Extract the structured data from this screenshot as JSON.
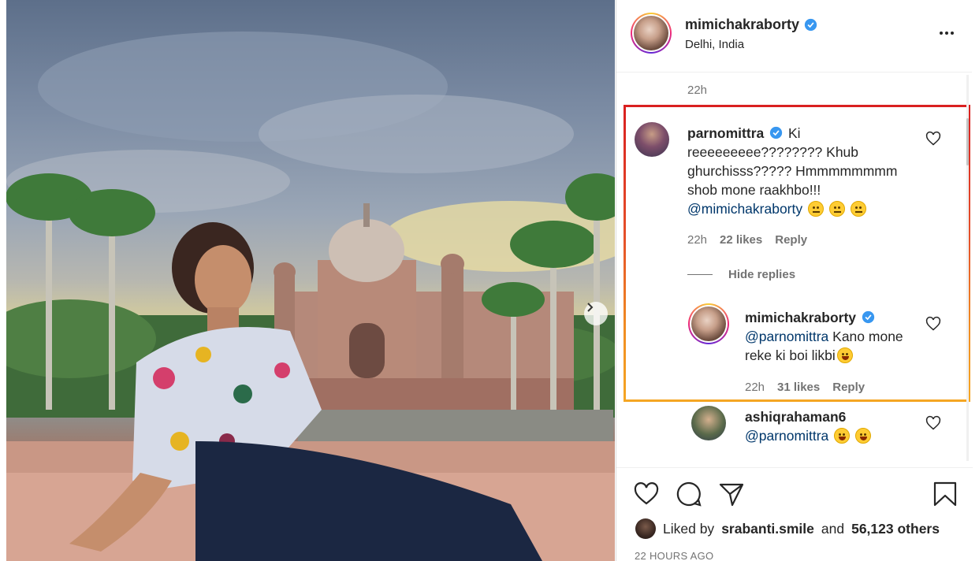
{
  "post": {
    "username": "mimichakraborty",
    "location": "Delhi, India",
    "caption_time": "22h",
    "more_icon": "more-horizontal-icon",
    "verified_color": "#3897f0"
  },
  "comments": [
    {
      "username": "parnomittra",
      "text": "Ki reeeeeeeee???????? Khub ghurchisss????? Hmmmmmmmm shob mone raakhbo!!!",
      "mention": "@mimichakraborty",
      "emojis": [
        "neutral-face-emoji",
        "neutral-face-emoji",
        "neutral-face-emoji"
      ],
      "time": "22h",
      "likes": "22 likes",
      "reply_label": "Reply",
      "hide_replies_label": "Hide replies",
      "replies": [
        {
          "username": "mimichakraborty",
          "mention": "@parnomittra",
          "text": "Kano mone reke ki boi likbi",
          "emojis": [
            "grinning-sweat-emoji"
          ],
          "time": "22h",
          "likes": "31 likes",
          "reply_label": "Reply"
        }
      ]
    },
    {
      "username": "ashiqrahaman6",
      "mention": "@parnomittra",
      "emojis": [
        "smiling-face-emoji",
        "rolling-laughing-emoji"
      ]
    }
  ],
  "highlight": {
    "border_colors": [
      "#d92020",
      "#f5a623"
    ]
  },
  "likes": {
    "prefix": "Liked by",
    "user": "srabanti.smile",
    "middle": "and",
    "others": "56,123 others"
  },
  "timestamp": "22 HOURS AGO",
  "actions": [
    "like-icon",
    "comment-icon",
    "share-icon",
    "save-icon"
  ],
  "image_nav_icon": "chevron-right-icon"
}
